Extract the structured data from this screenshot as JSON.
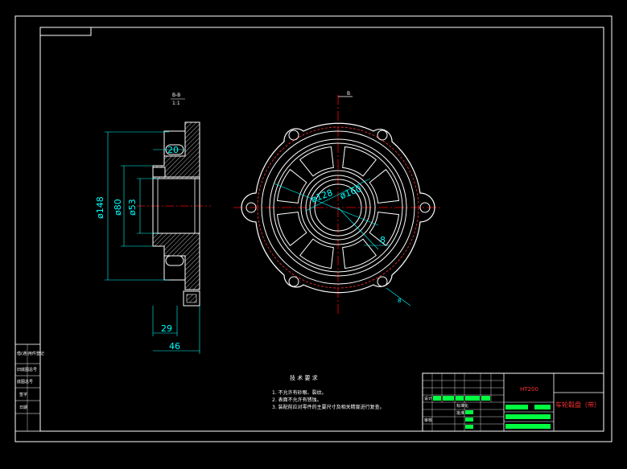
{
  "section_view": {
    "label": "B-B",
    "scale": "1:1",
    "dimensions": [
      "20",
      "ø148",
      "ø80",
      "ø53",
      "29",
      "46"
    ]
  },
  "front_view": {
    "section_marker": "B",
    "dimensions": [
      "ø128",
      "ø160",
      "8",
      "8"
    ]
  },
  "technical_requirements": {
    "heading": "技 术 要 求",
    "items": [
      "1. 不允许有砂眼、裂纹。",
      "2. 表面不允许有锈蚀。",
      "3. 装配前应对零件的主要尺寸及相关精度进行复查。"
    ]
  },
  "left_strip": {
    "cells": [
      "借(通)用件登记",
      "旧底图总号",
      "底图总号",
      "签字",
      "日期"
    ]
  },
  "title_block": {
    "part_name": "车轮毂盘（带）",
    "material": "HT200",
    "row_labels": [
      "设计",
      "审核",
      "标准化",
      "批准"
    ]
  },
  "colors": {
    "background": "#000000",
    "frame": "#ffffff",
    "dimension": "#00ffff",
    "centerline": "#ff0000",
    "highlight": "#00ff40"
  }
}
